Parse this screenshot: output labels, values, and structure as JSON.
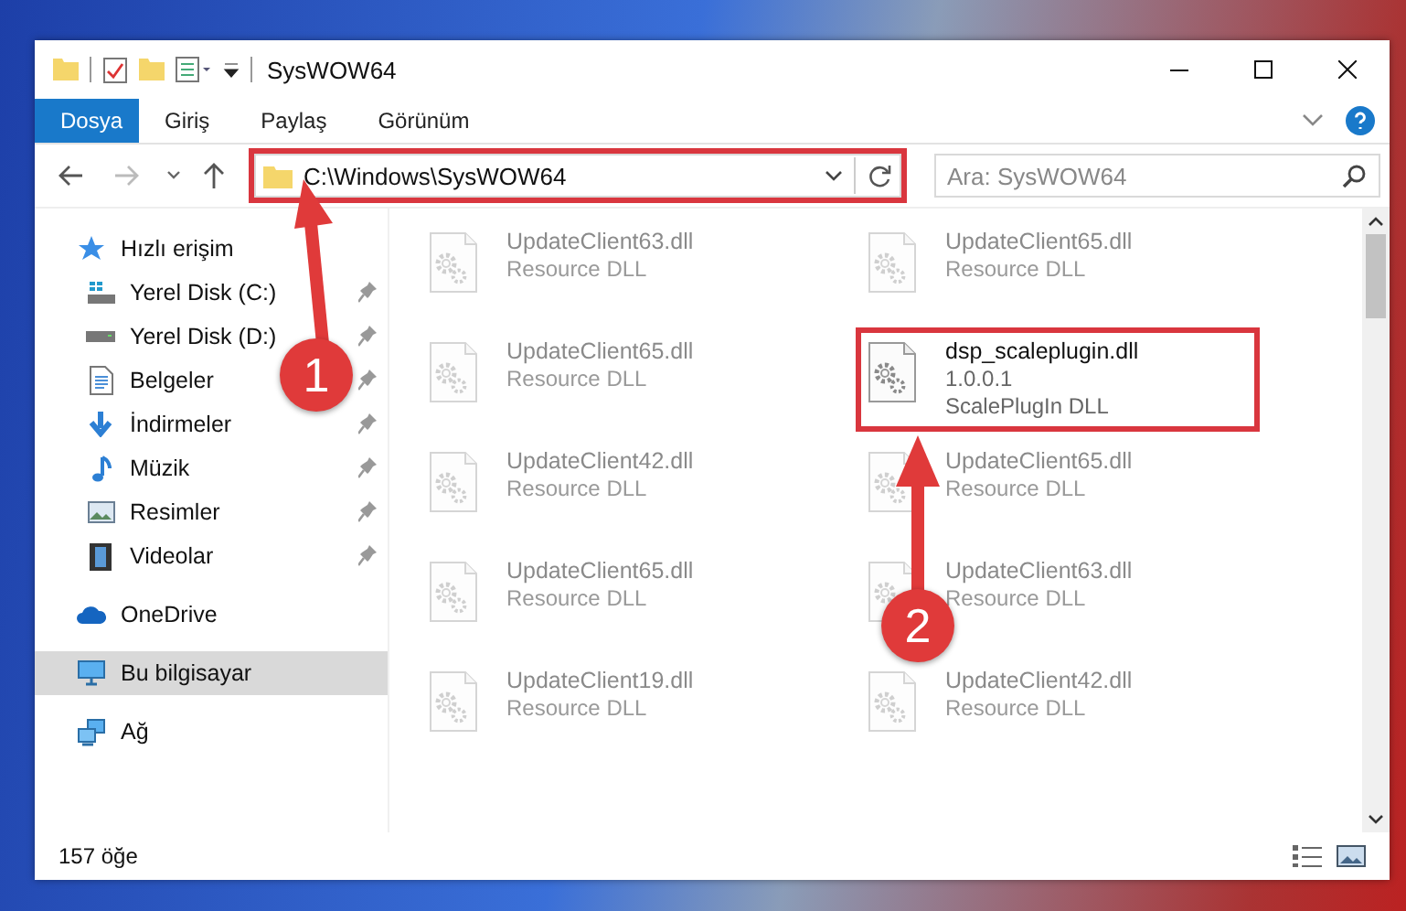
{
  "window": {
    "title": "SysWOW64"
  },
  "ribbon_tabs": [
    {
      "label": "Dosya",
      "selected": true
    },
    {
      "label": "Giriş",
      "selected": false
    },
    {
      "label": "Paylaş",
      "selected": false
    },
    {
      "label": "Görünüm",
      "selected": false
    }
  ],
  "address": {
    "value": "C:\\Windows\\SysWOW64",
    "highlighted": true
  },
  "search": {
    "placeholder": "Ara: SysWOW64"
  },
  "sidebar": {
    "items": [
      {
        "label": "Hızlı erişim",
        "selected": false,
        "children": [
          {
            "label": "Yerel Disk (C:)",
            "pinned": true,
            "selected": false
          },
          {
            "label": "Yerel Disk (D:)",
            "pinned": true,
            "selected": false
          },
          {
            "label": "Belgeler",
            "pinned": true,
            "selected": false
          },
          {
            "label": "İndirmeler",
            "pinned": true,
            "selected": false
          },
          {
            "label": "Müzik",
            "pinned": true,
            "selected": false
          },
          {
            "label": "Resimler",
            "pinned": true,
            "selected": false
          },
          {
            "label": "Videolar",
            "pinned": true,
            "selected": false
          }
        ]
      },
      {
        "label": "OneDrive",
        "selected": false
      },
      {
        "label": "Bu bilgisayar",
        "selected": true
      },
      {
        "label": "Ağ",
        "selected": false
      }
    ]
  },
  "files": [
    {
      "name": "UpdateClient63.dll",
      "lines": [
        "Resource DLL"
      ],
      "kind": "blurred",
      "highlighted": false
    },
    {
      "name": "UpdateClient65.dll",
      "lines": [
        "Resource DLL"
      ],
      "kind": "blurred",
      "highlighted": false
    },
    {
      "name": "UpdateClient65.dll",
      "lines": [
        "Resource DLL"
      ],
      "kind": "blurred",
      "highlighted": false
    },
    {
      "name": "dsp_scaleplugin.dll",
      "lines": [
        "1.0.0.1",
        "ScalePlugIn DLL"
      ],
      "kind": "sharp",
      "highlighted": true
    },
    {
      "name": "UpdateClient42.dll",
      "lines": [
        "Resource DLL"
      ],
      "kind": "blurred",
      "highlighted": false
    },
    {
      "name": "UpdateClient65.dll",
      "lines": [
        "Resource DLL"
      ],
      "kind": "blurred",
      "highlighted": false
    },
    {
      "name": "UpdateClient65.dll",
      "lines": [
        "Resource DLL"
      ],
      "kind": "blurred",
      "highlighted": false
    },
    {
      "name": "UpdateClient63.dll",
      "lines": [
        "Resource DLL"
      ],
      "kind": "blurred",
      "highlighted": false
    },
    {
      "name": "UpdateClient19.dll",
      "lines": [
        "Resource DLL"
      ],
      "kind": "blurred",
      "highlighted": false
    },
    {
      "name": "UpdateClient42.dll",
      "lines": [
        "Resource DLL"
      ],
      "kind": "blurred",
      "highlighted": false
    }
  ],
  "status_bar": {
    "count": "157 öğe"
  },
  "annotations": [
    {
      "label": "1"
    },
    {
      "label": "2"
    }
  ]
}
